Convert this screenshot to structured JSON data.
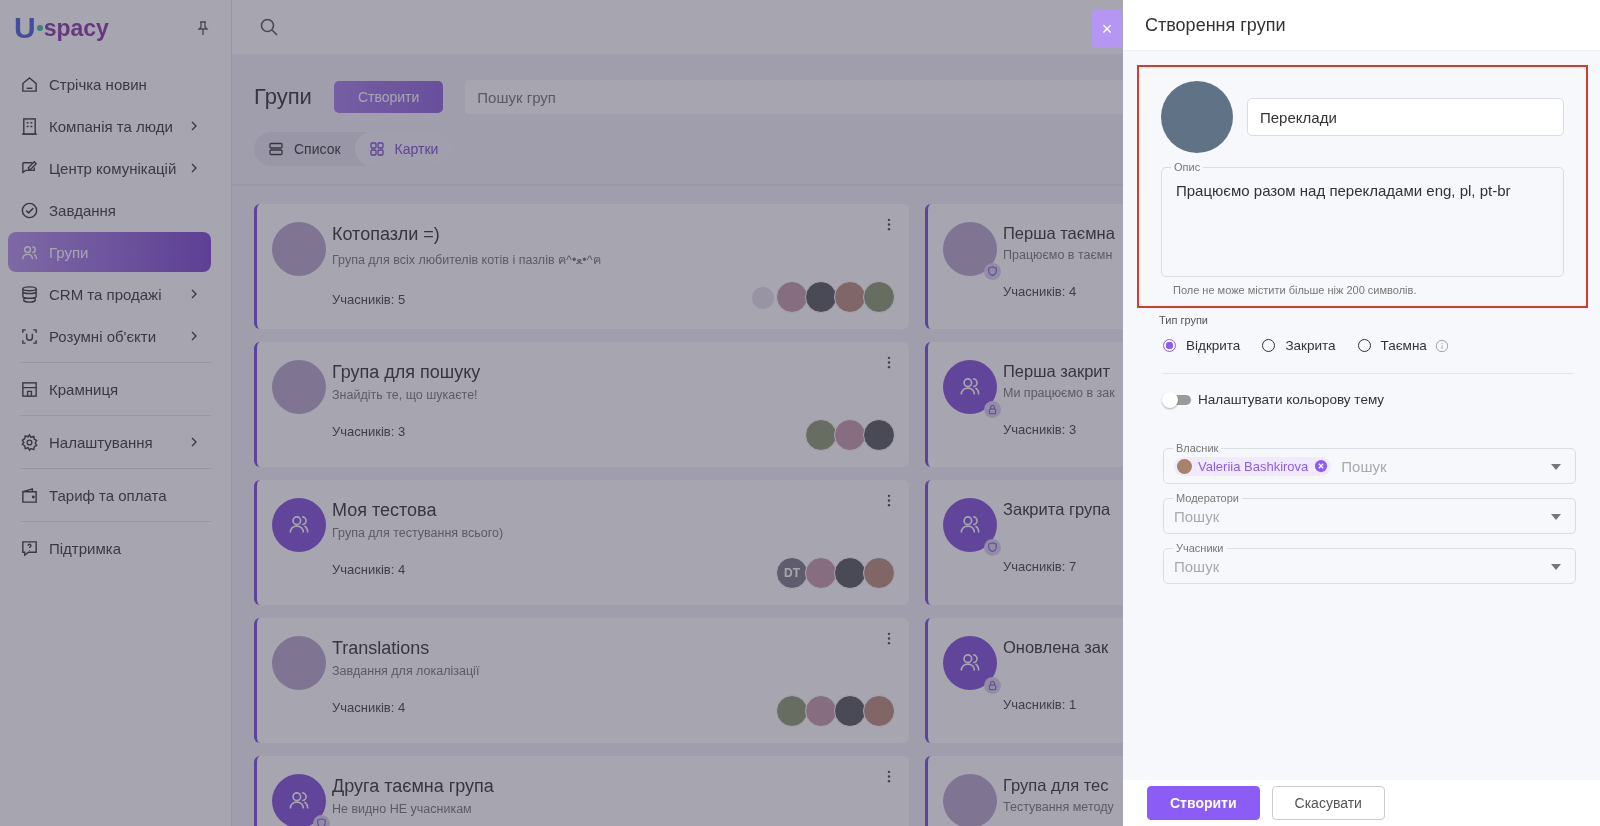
{
  "logo": {
    "mark": "U",
    "text": "spacy"
  },
  "sidebar": {
    "sections": [
      [
        {
          "label": "Стрічка новин",
          "has_submenu": false,
          "selected": false
        },
        {
          "label": "Компанія та люди",
          "has_submenu": true,
          "selected": false
        },
        {
          "label": "Центр комунікацій",
          "has_submenu": true,
          "selected": false
        },
        {
          "label": "Завдання",
          "has_submenu": false,
          "selected": false
        },
        {
          "label": "Групи",
          "has_submenu": false,
          "selected": true
        },
        {
          "label": "CRM та продажі",
          "has_submenu": true,
          "selected": false
        },
        {
          "label": "Розумні об'єкти",
          "has_submenu": true,
          "selected": false
        }
      ],
      [
        {
          "label": "Крамниця",
          "has_submenu": false,
          "selected": false
        }
      ],
      [
        {
          "label": "Налаштування",
          "has_submenu": true,
          "selected": false
        }
      ],
      [
        {
          "label": "Тариф та оплата",
          "has_submenu": false,
          "selected": false
        }
      ],
      [
        {
          "label": "Підтримка",
          "has_submenu": false,
          "selected": false
        }
      ]
    ]
  },
  "page": {
    "title": "Групи",
    "create_button": "Створити",
    "search": {
      "placeholder": "Пошук груп"
    },
    "views": [
      {
        "label": "Список",
        "selected": false
      },
      {
        "label": "Картки",
        "selected": true
      }
    ]
  },
  "cards": [
    {
      "title": "Котопазли =)",
      "description": "Група для всіх любителів котів і пазлів ฅ^•ﻌ•^ฅ",
      "members": "Учасників: 5",
      "avatar": {
        "kind": "photo"
      },
      "member_avatars": [
        {
          "kind": "sticker"
        },
        {
          "kind": "photo"
        },
        {
          "kind": "photo"
        },
        {
          "kind": "photo"
        },
        {
          "kind": "photo"
        }
      ]
    },
    {
      "title": "Перша таємна",
      "description": "Працюємо в таємн",
      "members": "Учасників: 4",
      "avatar": {
        "kind": "photo"
      },
      "badge": {
        "kind": "shield"
      }
    },
    {
      "title": "Група для пошуку",
      "description": "Знайдіть те, що шукаєте!",
      "members": "Учасників: 3",
      "avatar": {
        "kind": "photo"
      },
      "member_avatars": [
        {
          "kind": "photo"
        },
        {
          "kind": "photo"
        },
        {
          "kind": "photo"
        }
      ]
    },
    {
      "title": "Перша закрит",
      "description": "Ми працюємо в зак",
      "members": "Учасників: 3",
      "avatar": {
        "kind": "default"
      },
      "badge": {
        "kind": "lock"
      }
    },
    {
      "title": "Моя тестова",
      "description": "Група для тестування всього)",
      "members": "Учасників: 4",
      "avatar": {
        "kind": "default"
      },
      "member_avatars": [
        {
          "kind": "initials",
          "text": "DT"
        },
        {
          "kind": "photo"
        },
        {
          "kind": "photo"
        },
        {
          "kind": "photo"
        }
      ]
    },
    {
      "title": "Закрита група",
      "members": "Учасників: 7",
      "avatar": {
        "kind": "default"
      },
      "badge": {
        "kind": "shield"
      }
    },
    {
      "title": "Translations",
      "description": "Завдання для локалізації",
      "members": "Учасників: 4",
      "avatar": {
        "kind": "photo"
      },
      "member_avatars": [
        {
          "kind": "photo"
        },
        {
          "kind": "photo"
        },
        {
          "kind": "photo"
        },
        {
          "kind": "photo"
        }
      ]
    },
    {
      "title": "Оновлена зак",
      "members": "Учасників: 1",
      "avatar": {
        "kind": "default"
      },
      "badge": {
        "kind": "lock"
      }
    },
    {
      "title": "Друга таємна група",
      "description": "Не видно НЕ учасникам",
      "avatar": {
        "kind": "default"
      },
      "badge": {
        "kind": "shield"
      }
    },
    {
      "title": "Група для тес",
      "description": "Тестування методу",
      "avatar": {
        "kind": "photo"
      }
    }
  ],
  "drawer": {
    "close": "×",
    "title": "Створення групи",
    "name": {
      "value": "Переклади"
    },
    "description": {
      "label": "Опис",
      "value": "Працюємо разом над перекладами eng, pl, pt-br",
      "hint": "Поле не може містити більше ніж 200 символів."
    },
    "group_type": {
      "label": "Тип групи",
      "options": [
        {
          "label": "Відкрита",
          "selected": true,
          "info": false
        },
        {
          "label": "Закрита",
          "selected": false,
          "info": false
        },
        {
          "label": "Таємна",
          "selected": false,
          "info": true
        }
      ]
    },
    "color_theme": {
      "label": "Налаштувати кольорову тему",
      "on": false
    },
    "fields": [
      {
        "label": "Власник",
        "chips": [
          "Valeriia Bashkirova"
        ],
        "placeholder": "Пошук"
      },
      {
        "label": "Модератори",
        "placeholder": "Пошук"
      },
      {
        "label": "Учасники",
        "placeholder": "Пошук"
      }
    ],
    "buttons": [
      {
        "label": "Створити",
        "kind": "primary"
      },
      {
        "label": "Скасувати",
        "kind": "secondary"
      }
    ]
  }
}
